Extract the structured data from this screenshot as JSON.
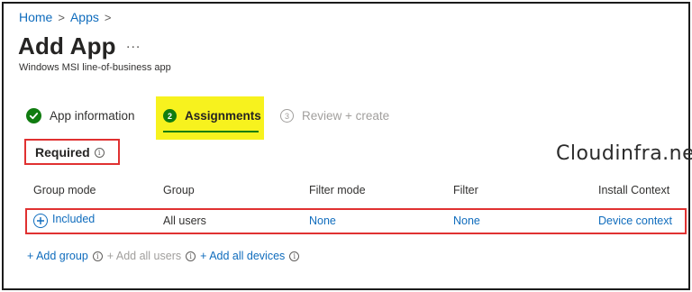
{
  "breadcrumb": {
    "items": [
      "Home",
      "Apps"
    ],
    "separator": ">"
  },
  "header": {
    "title": "Add App",
    "more": "...",
    "subtitle": "Windows MSI line-of-business app"
  },
  "wizard": {
    "steps": [
      {
        "label": "App information",
        "state": "completed",
        "marker": ""
      },
      {
        "label": "Assignments",
        "state": "active",
        "marker": "2"
      },
      {
        "label": "Review + create",
        "state": "pending",
        "marker": "3"
      }
    ]
  },
  "section": {
    "title": "Required",
    "info_icon": "info-icon"
  },
  "watermark": "Cloudinfra.net",
  "table": {
    "columns": [
      "Group mode",
      "Group",
      "Filter mode",
      "Filter",
      "Install Context"
    ],
    "rows": [
      {
        "group_mode": "Included",
        "group": "All users",
        "filter_mode": "None",
        "filter": "None",
        "install_context": "Device context"
      }
    ]
  },
  "actions": {
    "add_group": "+ Add group",
    "add_all_users": "+ Add all users",
    "add_all_devices": "+ Add all devices"
  },
  "colors": {
    "link": "#0f6cbd",
    "success": "#107c10",
    "highlight": "#f7f21e",
    "callout": "#e03131"
  }
}
